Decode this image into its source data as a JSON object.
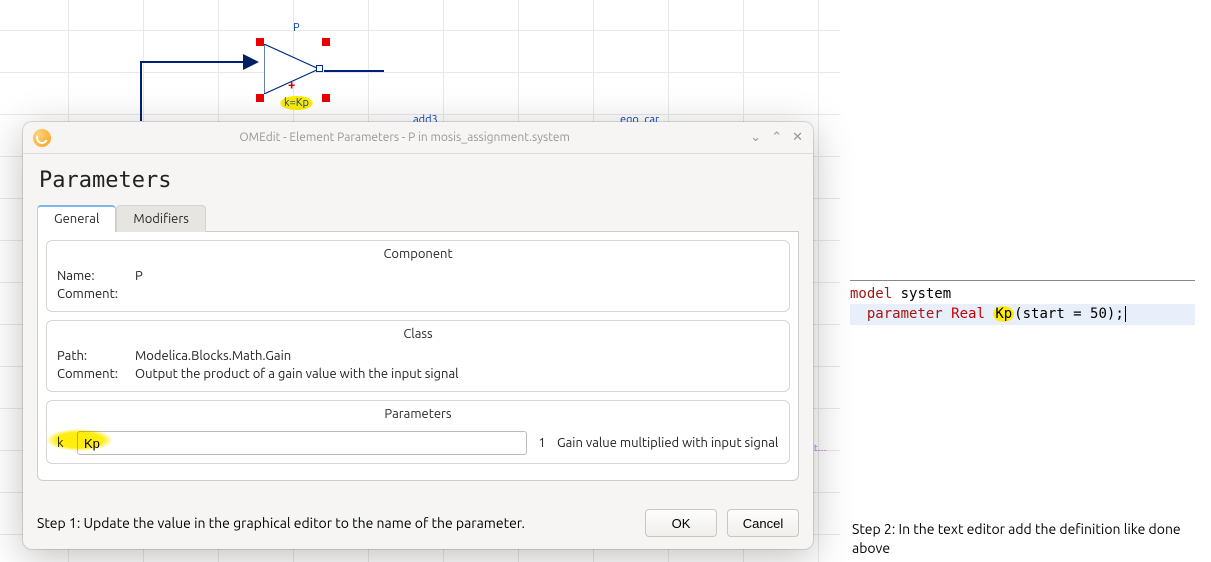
{
  "canvas": {
    "block_top_label": "P",
    "block_bottom_label": "k=Kp",
    "other_label_1": "add3",
    "other_label_2": "ego_car"
  },
  "dialog": {
    "title": "OMEdit - Element Parameters - P in mosis_assignment.system",
    "heading": "Parameters",
    "tabs": {
      "general": "General",
      "modifiers": "Modifiers"
    },
    "component": {
      "group_title": "Component",
      "name_label": "Name:",
      "name_value": "P",
      "comment_label": "Comment:",
      "comment_value": ""
    },
    "klass": {
      "group_title": "Class",
      "path_label": "Path:",
      "path_value": "Modelica.Blocks.Math.Gain",
      "comment_label": "Comment:",
      "comment_value": "Output the product of a gain value with the input signal"
    },
    "params": {
      "group_title": "Parameters",
      "k_label": "k",
      "k_value": "Kp",
      "k_unit": "1",
      "k_desc": "Gain value multiplied with input signal"
    },
    "step1": "Step 1: Update the value in the graphical editor to the name of the parameter.",
    "ok": "OK",
    "cancel": "Cancel"
  },
  "code": {
    "kw_model": "model",
    "name": "system",
    "kw_parameter": "parameter",
    "type_real": "Real",
    "ident": "Kp",
    "rest": "(start = 50);"
  },
  "step2": "Step 2: In the text editor add the definition like done above"
}
